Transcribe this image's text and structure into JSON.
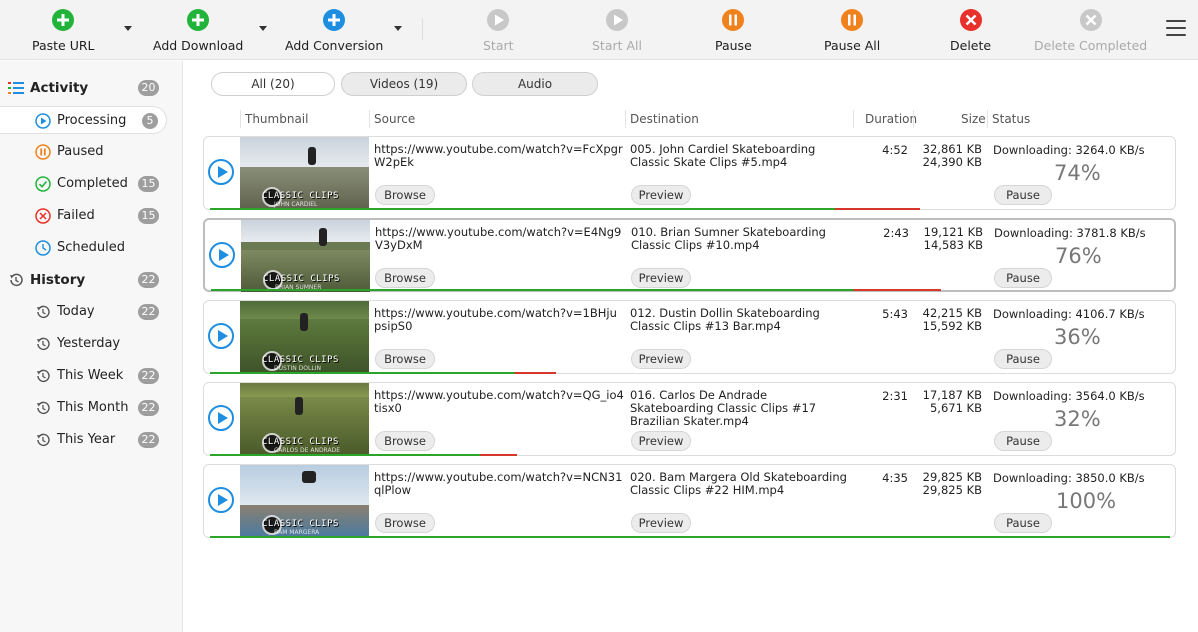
{
  "toolbar": {
    "paste_url": "Paste URL",
    "add_download": "Add Download",
    "add_conversion": "Add Conversion",
    "start": "Start",
    "start_all": "Start All",
    "pause": "Pause",
    "pause_all": "Pause All",
    "delete": "Delete",
    "delete_completed": "Delete Completed"
  },
  "sidebar": {
    "activity": {
      "label": "Activity",
      "count": "20"
    },
    "processing": {
      "label": "Processing",
      "count": "5"
    },
    "paused": {
      "label": "Paused",
      "count": ""
    },
    "completed": {
      "label": "Completed",
      "count": "15"
    },
    "failed": {
      "label": "Failed",
      "count": "15"
    },
    "scheduled": {
      "label": "Scheduled",
      "count": ""
    },
    "history": {
      "label": "History",
      "count": "22"
    },
    "today": {
      "label": "Today",
      "count": "22"
    },
    "yesterday": {
      "label": "Yesterday",
      "count": ""
    },
    "this_week": {
      "label": "This Week",
      "count": "22"
    },
    "this_month": {
      "label": "This Month",
      "count": "22"
    },
    "this_year": {
      "label": "This Year",
      "count": "22"
    }
  },
  "filters": {
    "all": "All (20)",
    "videos": "Videos (19)",
    "audio": "Audio"
  },
  "columns": {
    "thumbnail": "Thumbnail",
    "source": "Source",
    "destination": "Destination",
    "duration": "Duration",
    "size": "Size",
    "status": "Status"
  },
  "buttons": {
    "browse": "Browse",
    "preview": "Preview",
    "pause": "Pause"
  },
  "rows": [
    {
      "thumb_title": "CLASSIC CLIPS",
      "thumb_sub": "JOHN CARDIEL",
      "source": "https://www.youtube.com/watch?v=FcXpgrW2pEk",
      "destination": "005. John Cardiel Skateboarding Classic Skate Clips #5.mp4",
      "duration": "4:52",
      "size_total": "32,861 KB",
      "size_done": "24,390 KB",
      "status": "Downloading: 3264.0 KB/s",
      "percent": "74%",
      "progress": 0.74
    },
    {
      "thumb_title": "CLASSIC CLIPS",
      "thumb_sub": "BRIAN SUMNER",
      "source": "https://www.youtube.com/watch?v=E4Ng9V3yDxM",
      "destination": "010. Brian Sumner Skateboarding Classic Clips #10.mp4",
      "duration": "2:43",
      "size_total": "19,121 KB",
      "size_done": "14,583 KB",
      "status": "Downloading: 3781.8 KB/s",
      "percent": "76%",
      "progress": 0.76
    },
    {
      "thumb_title": "CLASSIC CLIPS",
      "thumb_sub": "DUSTIN DOLLIN",
      "source": "https://www.youtube.com/watch?v=1BHjupsipS0",
      "destination": "012. Dustin Dollin Skateboarding Classic Clips #13 Bar.mp4",
      "duration": "5:43",
      "size_total": "42,215 KB",
      "size_done": "15,592 KB",
      "status": "Downloading: 4106.7 KB/s",
      "percent": "36%",
      "progress": 0.36
    },
    {
      "thumb_title": "CLASSIC CLIPS",
      "thumb_sub": "CARLOS DE ANDRADE",
      "source": "https://www.youtube.com/watch?v=QG_io4tisx0",
      "destination": "016. Carlos De Andrade Skateboarding Classic Clips #17 Brazilian Skater.mp4",
      "duration": "2:31",
      "size_total": "17,187 KB",
      "size_done": "5,671 KB",
      "status": "Downloading: 3564.0 KB/s",
      "percent": "32%",
      "progress": 0.32
    },
    {
      "thumb_title": "CLASSIC CLIPS",
      "thumb_sub": "BAM MARGERA",
      "source": "https://www.youtube.com/watch?v=NCN31qlPlow",
      "destination": "020. Bam Margera Old Skateboarding Classic Clips #22 HIM.mp4",
      "duration": "4:35",
      "size_total": "29,825 KB",
      "size_done": "29,825 KB",
      "status": "Downloading: 3850.0 KB/s",
      "percent": "100%",
      "progress": 1.0
    }
  ],
  "colors": {
    "green": "#22b33a",
    "blue": "#1e8fe0",
    "orange": "#f0821e",
    "red": "#e8312a",
    "gray_disabled": "#c8c8c8",
    "progress_green": "#2aa52a",
    "progress_red": "#d9362b"
  }
}
